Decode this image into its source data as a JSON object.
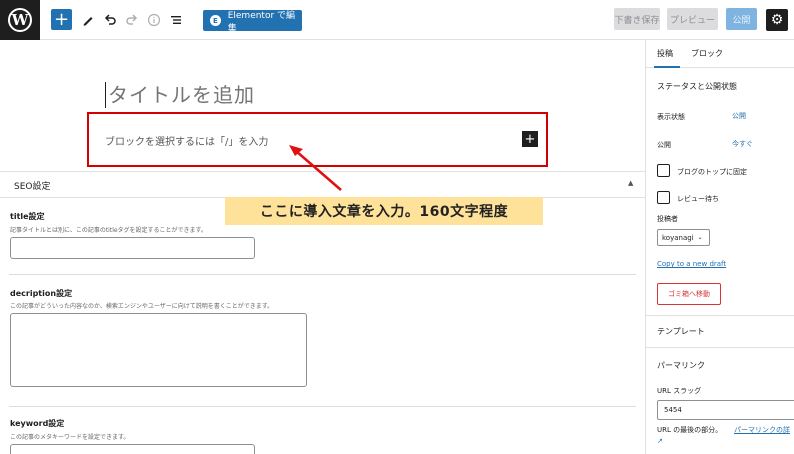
{
  "toolbar": {
    "elementor_label": "Elementor で編集",
    "save_draft_label": "下書き保存",
    "preview_label": "プレビュー",
    "publish_label": "公開",
    "icons": [
      "wordpress-icon",
      "plus-icon",
      "pencil-icon",
      "undo-icon",
      "redo-icon",
      "info-icon",
      "list-view-icon",
      "gear-icon"
    ]
  },
  "editor": {
    "title_placeholder": "タイトルを追加",
    "block_placeholder": "ブロックを選択するには「/」を入力",
    "annotation": "ここに導入文章を入力。160文字程度"
  },
  "seo": {
    "header": "SEO設定",
    "title_label": "title設定",
    "title_desc": "記事タイトルとは別に、この記事のtitleタグを設定することができます。",
    "description_label": "decription設定",
    "description_desc": "この記事がどういった内容なのか、検索エンジンやユーザーに向けて説明を書くことができます。",
    "keyword_label": "keyword設定",
    "keyword_desc": "この記事のメタキーワードを設定できます。"
  },
  "sidebar": {
    "tabs": [
      "投稿",
      "ブロック"
    ],
    "status_title": "ステータスと公開状態",
    "visibility_label": "表示状態",
    "visibility_value": "公開",
    "publish_label": "公開",
    "publish_value": "今すぐ",
    "sticky_label": "ブログのトップに固定",
    "pending_label": "レビュー待ち",
    "author_label": "投稿者",
    "author_value": "koyanagi",
    "copy_draft_link": "Copy to a new draft",
    "trash_button": "ゴミ箱へ移動",
    "template_title": "テンプレート",
    "permalink_title": "パーマリンク",
    "url_slug_label": "URL スラッグ",
    "url_slug_value": "5454",
    "url_last_part": "URL の最後の部分。",
    "permalink_link": "パーマリンクの詳"
  },
  "colors": {
    "accent": "#2271b1",
    "highlight_box": "#d40000",
    "annotation_bg": "#ffe29a"
  }
}
